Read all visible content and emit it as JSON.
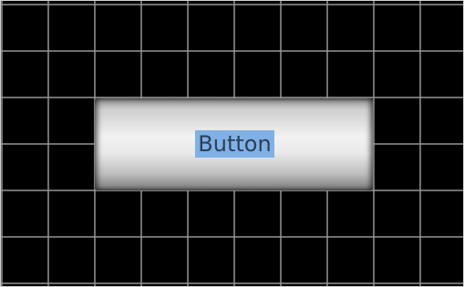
{
  "canvas": {
    "background_color": "#000000",
    "grid_color": "#969696",
    "grid": true
  },
  "button": {
    "label": "Button",
    "label_selected": true,
    "selection_color": "#7fb1e6"
  }
}
